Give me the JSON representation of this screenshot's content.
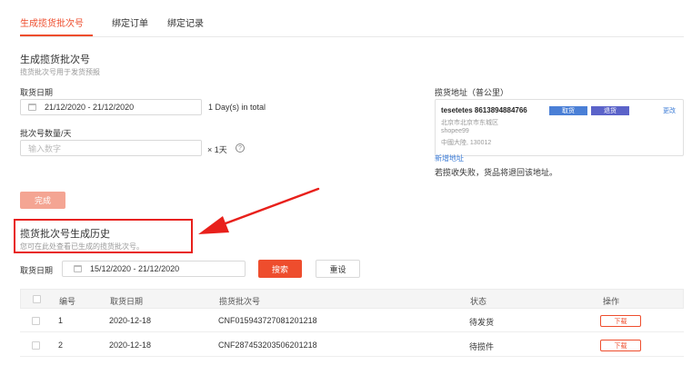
{
  "tabs": [
    {
      "label": "生成揽货批次号",
      "active": true
    },
    {
      "label": "绑定订单",
      "active": false
    },
    {
      "label": "绑定记录",
      "active": false
    }
  ],
  "generate": {
    "title": "生成揽货批次号",
    "subtitle": "揽货批次号用于发货预报",
    "pickup_date_label": "取货日期",
    "pickup_date_value": "21/12/2020 - 21/12/2020",
    "days_total": "1 Day(s) in total",
    "batch_qty_label": "批次号数量/天",
    "batch_qty_placeholder": "输入数字",
    "batch_qty_suffix": "× 1天",
    "help_icon": "question-circle-icon",
    "done_button": "完成"
  },
  "address": {
    "label": "揽货地址（普公里）",
    "name_phone": "tesetetes 8613894884766",
    "tag_default": "取货",
    "tag_return": "退货",
    "edit_link": "更改",
    "line1": "北京市北京市东城区",
    "line2": "shopee99",
    "line3": "中國大陸, 130012",
    "add_link": "新增地址",
    "note": "若揽收失败，货品将退回该地址。",
    "colors": {
      "tag_default": "#4a7fd6",
      "tag_return": "#5b63c9"
    }
  },
  "history": {
    "title": "揽货批次号生成历史",
    "subtitle": "您可在此处查看已生成的揽货批次号。",
    "date_label": "取货日期",
    "date_value": "15/12/2020 - 21/12/2020",
    "search_button": "搜索",
    "reset_button": "重设"
  },
  "table": {
    "headers": [
      "编号",
      "取货日期",
      "揽货批次号",
      "状态",
      "操作"
    ],
    "rows": [
      {
        "index": "1",
        "date": "2020-12-18",
        "batch": "CNF015943727081201218",
        "status": "待发货",
        "action": "下载"
      },
      {
        "index": "2",
        "date": "2020-12-18",
        "batch": "CNF287453203506201218",
        "status": "待揽件",
        "action": "下载"
      }
    ]
  },
  "colors": {
    "accent": "#ee4d2d",
    "annotation": "#e8201b"
  }
}
